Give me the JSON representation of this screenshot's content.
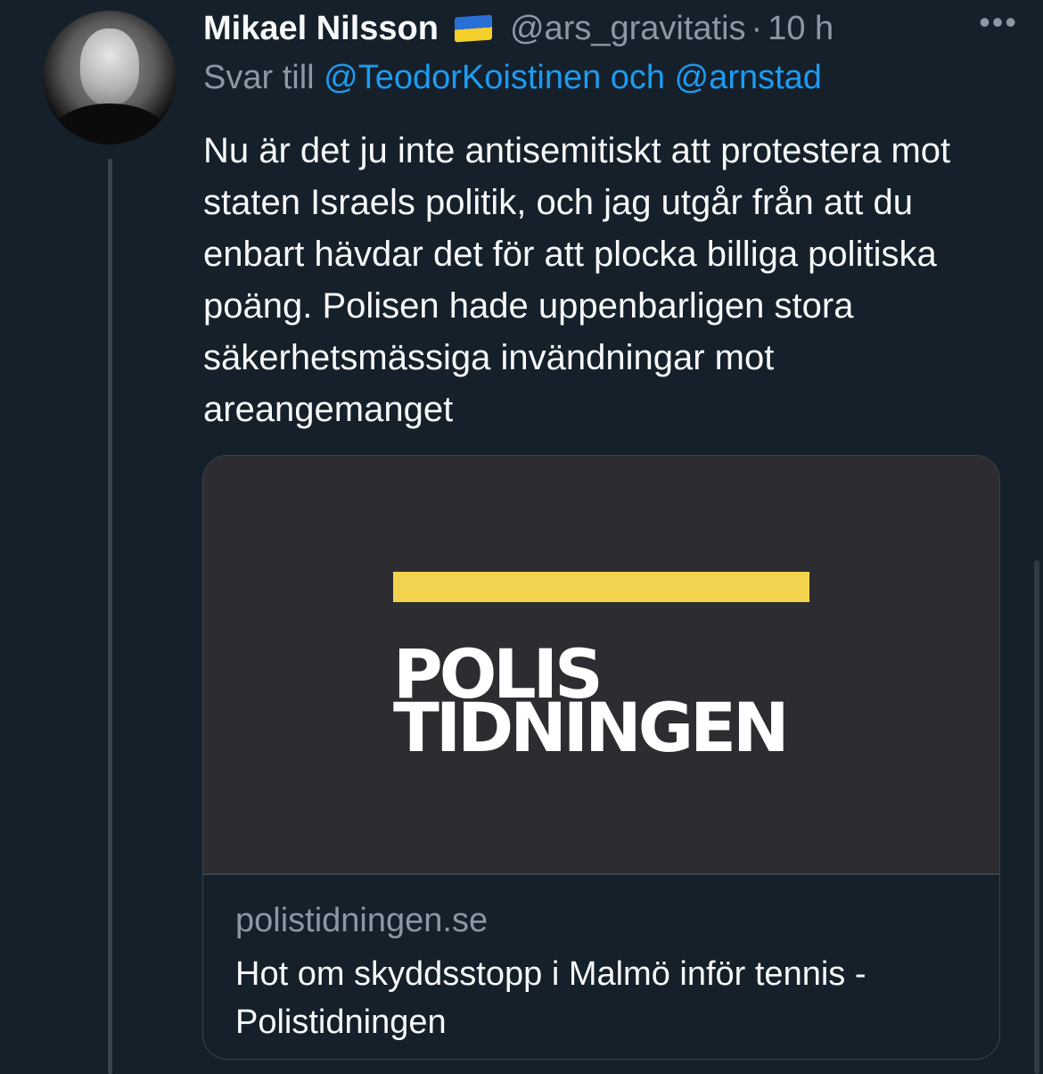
{
  "tweet": {
    "author_name": "Mikael Nilsson",
    "flag_icon": "ukraine-flag-icon",
    "handle": "@ars_gravitatis",
    "separator": "·",
    "time": "10 h",
    "more_icon": "•••",
    "reply_prefix": "Svar till",
    "reply_to": "@TeodorKoistinen och @arnstad",
    "text": "Nu är det ju inte antisemitiskt att protestera mot staten Israels politik, och jag utgår från att du enbart hävdar det för att plocka billiga politiska poäng. Polisen hade uppenbarligen stora säkerhetsmässiga invändningar mot areangemanget"
  },
  "card": {
    "logo_line1": "POLIS",
    "logo_line2": "TIDNINGEN",
    "domain": "polistidningen.se",
    "title": "Hot om skyddsstopp i Malmö inför tennis - Polistidningen"
  },
  "colors": {
    "background": "#15202b",
    "link": "#1d9bf0",
    "muted": "#8b98a5",
    "logo_yellow": "#f2d34f"
  }
}
